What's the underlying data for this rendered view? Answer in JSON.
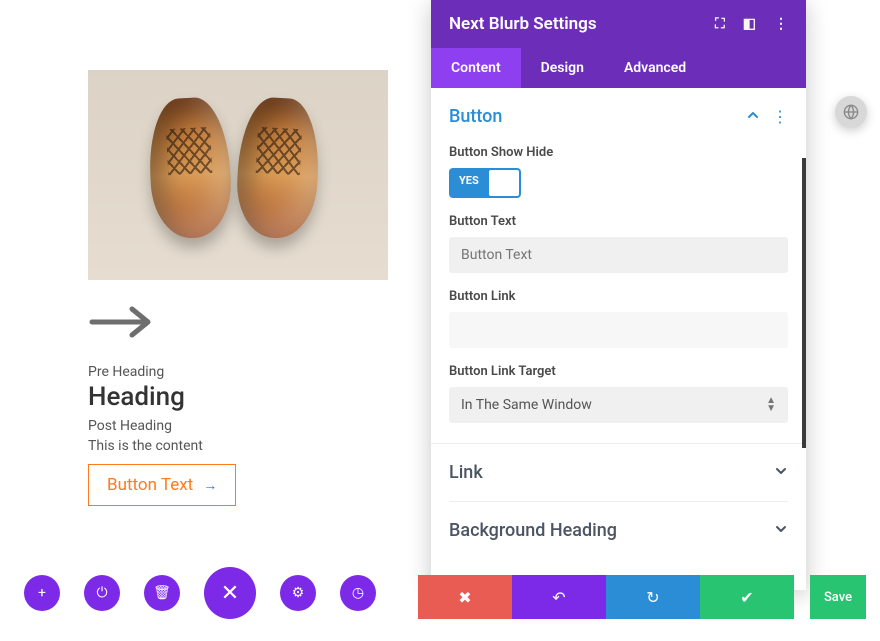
{
  "preview": {
    "pre_heading": "Pre Heading",
    "heading": "Heading",
    "post_heading": "Post Heading",
    "content": "This is the content",
    "button_label": "Button Text"
  },
  "panel": {
    "title": "Next Blurb Settings",
    "tabs": {
      "content": "Content",
      "design": "Design",
      "advanced": "Advanced"
    },
    "section_button": {
      "title": "Button",
      "show_hide_label": "Button Show Hide",
      "toggle_state": "YES",
      "text_label": "Button Text",
      "text_placeholder": "Button Text",
      "link_label": "Button Link",
      "target_label": "Button Link Target",
      "target_value": "In The Same Window"
    },
    "section_link": {
      "title": "Link"
    },
    "section_bg": {
      "title": "Background Heading"
    }
  },
  "save_label": "Save"
}
